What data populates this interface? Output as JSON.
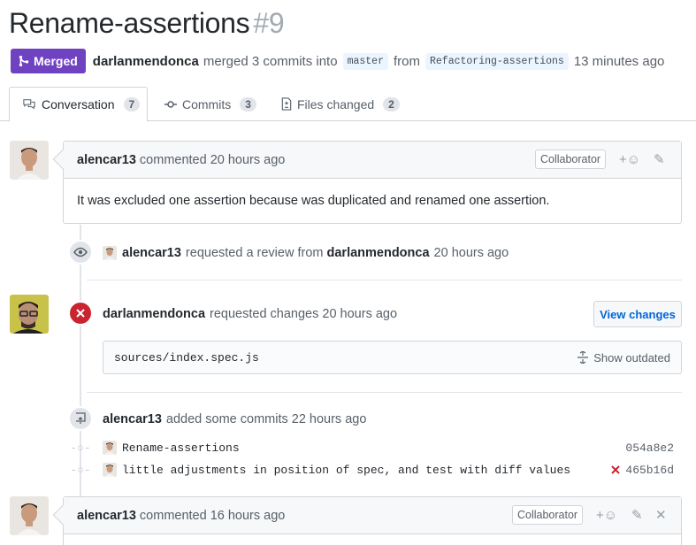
{
  "pr": {
    "title": "Rename-assertions",
    "number": "#9",
    "state": "Merged",
    "author": "darlanmendonca",
    "merged_text": "merged 3 commits into",
    "base_branch": "master",
    "from_text": "from",
    "head_branch": "Refactoring-assertions",
    "time": "13 minutes ago"
  },
  "tabs": [
    {
      "label": "Conversation",
      "count": "7"
    },
    {
      "label": "Commits",
      "count": "3"
    },
    {
      "label": "Files changed",
      "count": "2"
    }
  ],
  "comment1": {
    "author": "alencar13",
    "action": "commented 20 hours ago",
    "role": "Collaborator",
    "reaction": "+☺",
    "body": "It was excluded one assertion because was duplicated and renamed one assertion."
  },
  "review_request": {
    "actor": "alencar13",
    "text": "requested a review from",
    "target": "darlanmendonca",
    "time": "20 hours ago"
  },
  "changes_requested": {
    "actor": "darlanmendonca",
    "text": "requested changes 20 hours ago",
    "button": "View changes",
    "file": "sources/index.spec.js",
    "outdated": "Show outdated"
  },
  "commits_added": {
    "actor": "alencar13",
    "text": "added some commits 22 hours ago",
    "commits": [
      {
        "message": "Rename-assertions",
        "sha": "054a8e2",
        "failed": false
      },
      {
        "message": "little adjustments in position of spec, and test with diff values",
        "sha": "465b16d",
        "failed": true
      }
    ]
  },
  "comment2": {
    "author": "alencar13",
    "action": "commented 16 hours ago",
    "role": "Collaborator",
    "reaction": "+☺"
  },
  "colors": {
    "merged": "#6f42c1",
    "changes": "#cb2431",
    "link": "#0366d6"
  }
}
